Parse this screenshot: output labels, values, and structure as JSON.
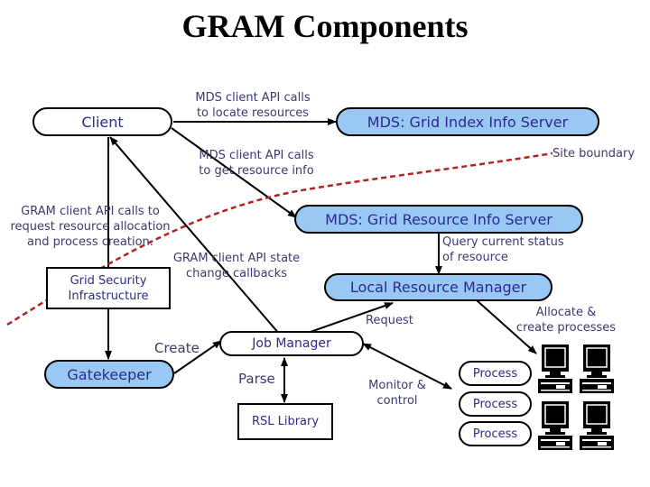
{
  "title": "GRAM Components",
  "colors": {
    "box_fill": "#99c8f5",
    "text": "#2b2b8c",
    "site_boundary": "#b22222"
  },
  "nodes": {
    "client": "Client",
    "index_server": "MDS: Grid Index Info Server",
    "resource_server": "MDS: Grid Resource Info Server",
    "local_rm": "Local Resource Manager",
    "gsi_line1": "Grid Security",
    "gsi_line2": "Infrastructure",
    "gatekeeper": "Gatekeeper",
    "job_manager": "Job Manager",
    "rsl_library": "RSL Library",
    "process_1": "Process",
    "process_2": "Process",
    "process_3": "Process"
  },
  "labels": {
    "locate_1": "MDS client API calls",
    "locate_2": "to locate resources",
    "getinfo_1": "MDS client API calls",
    "getinfo_2": "to get resource info",
    "site_boundary": "Site boundary",
    "gram_req_1": "GRAM client API calls to",
    "gram_req_2": "request resource allocation",
    "gram_req_3": "and process creation.",
    "callbacks_1": "GRAM client API state",
    "callbacks_2": "change callbacks",
    "query_1": "Query current status",
    "query_2": "of resource",
    "request": "Request",
    "allocate_1": "Allocate &",
    "allocate_2": "create processes",
    "create": "Create",
    "parse": "Parse",
    "monitor_1": "Monitor &",
    "monitor_2": "control"
  },
  "icons": [
    "computer-icon",
    "computer-icon",
    "computer-icon",
    "computer-icon"
  ]
}
